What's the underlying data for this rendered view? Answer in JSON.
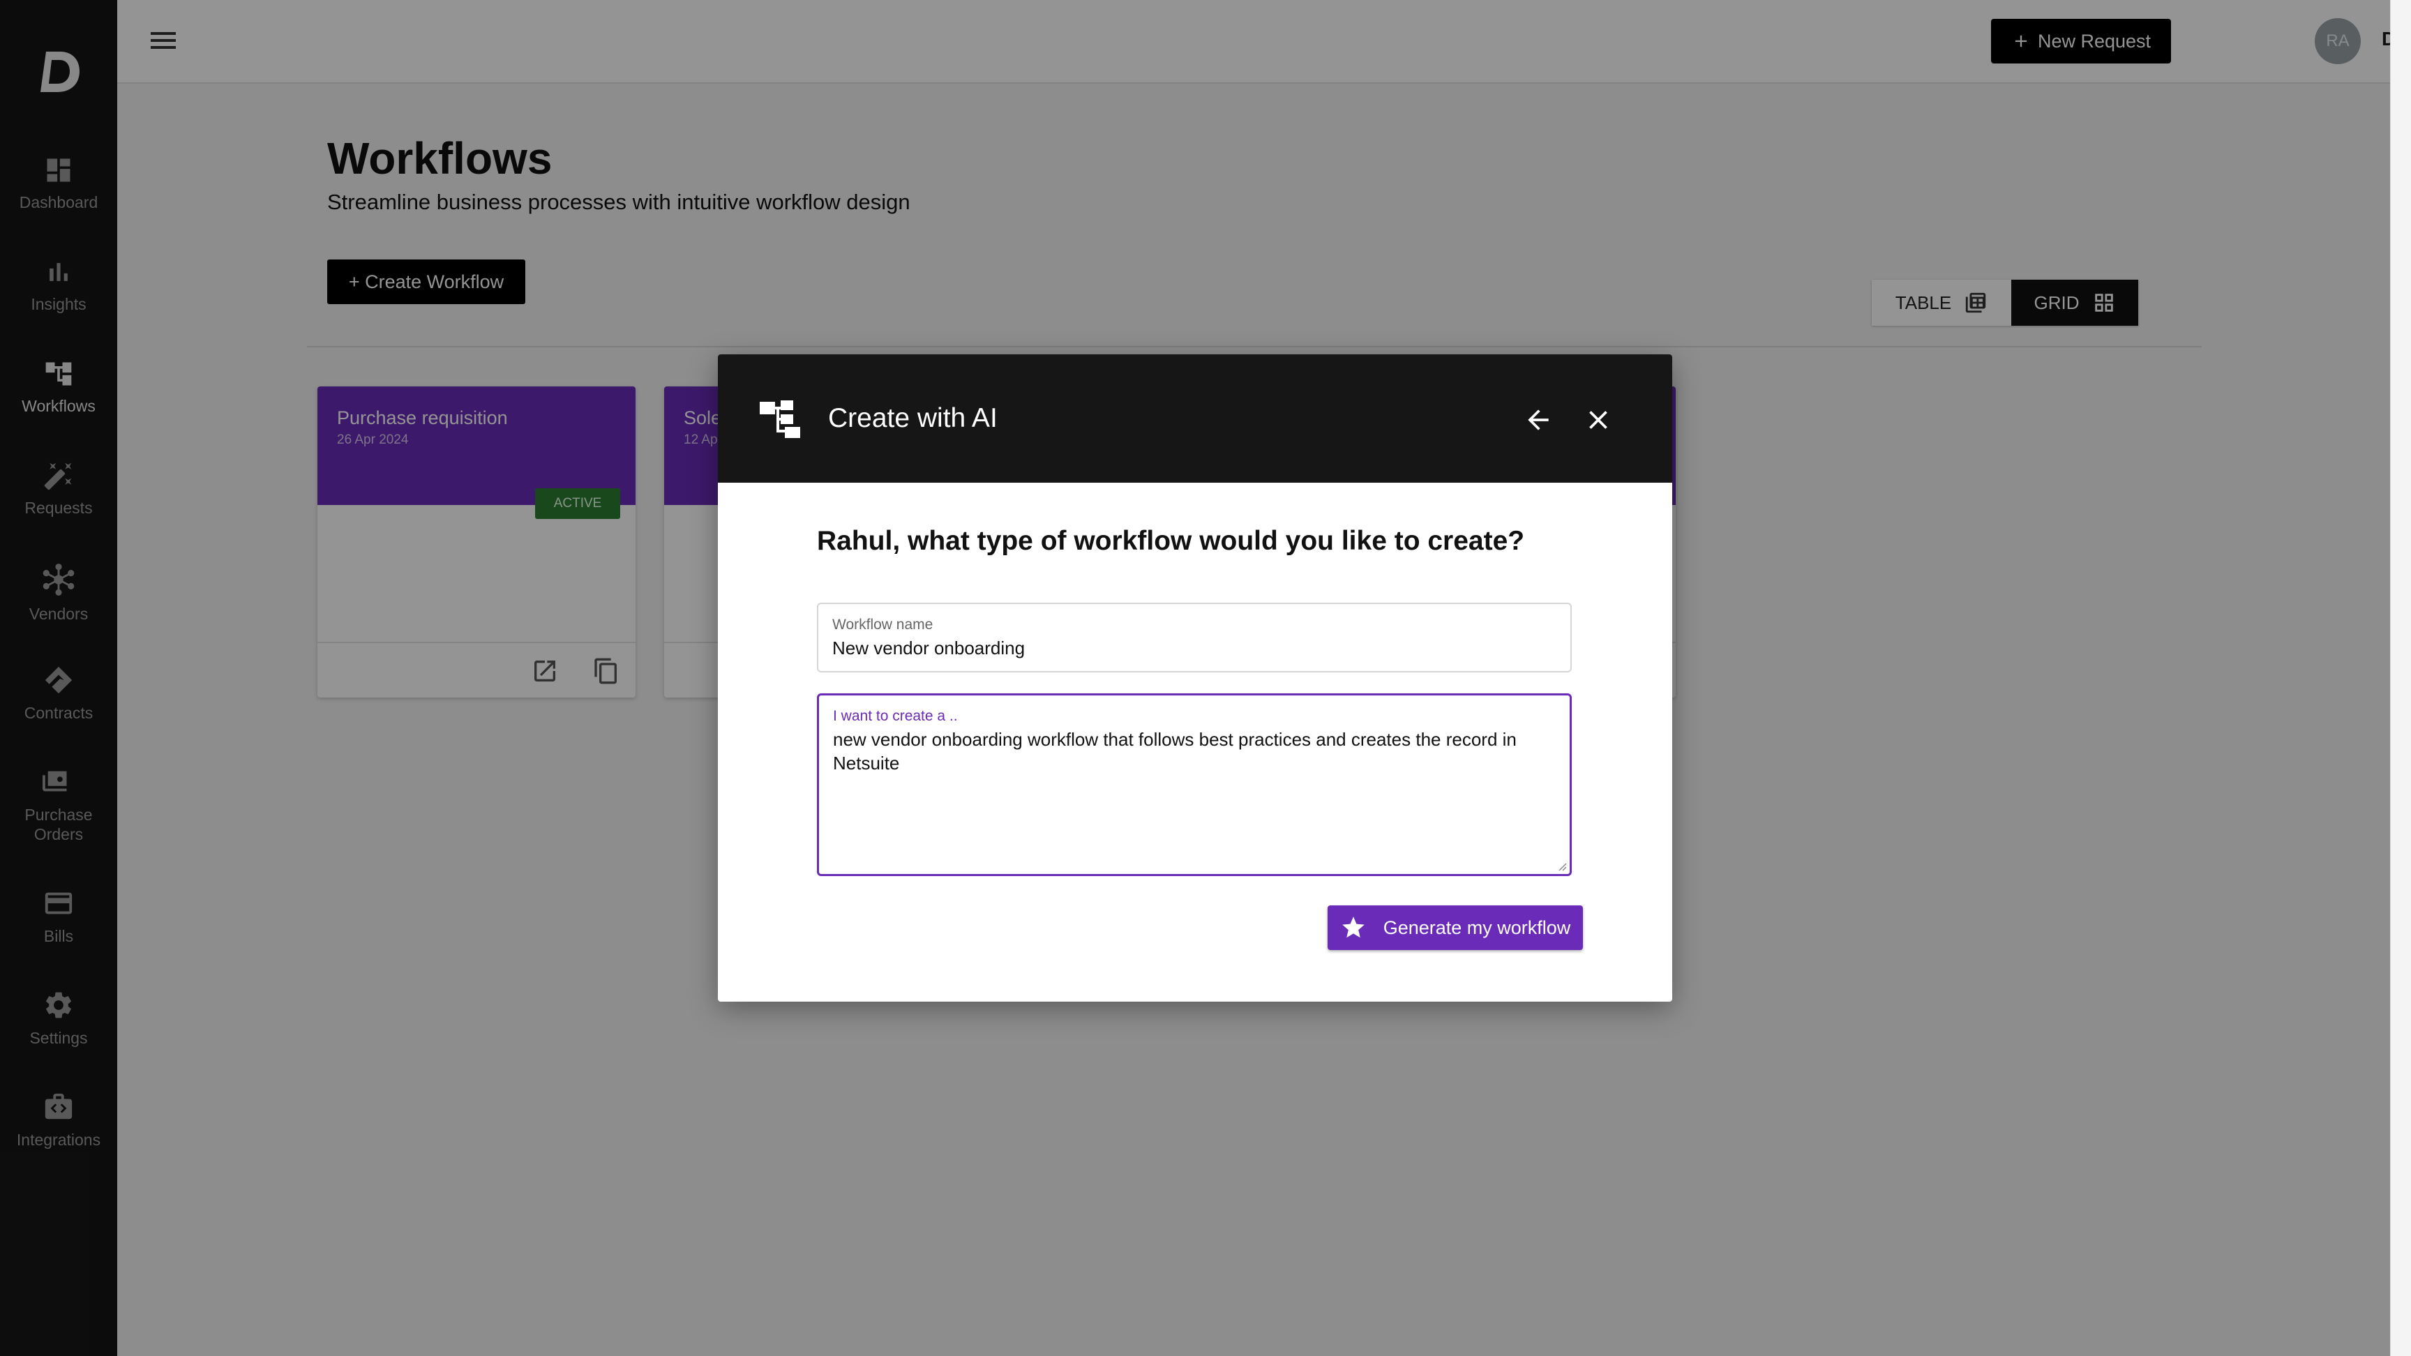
{
  "sidebar": {
    "logo": "D",
    "items": [
      {
        "label": "Dashboard",
        "icon": "dashboard-icon"
      },
      {
        "label": "Insights",
        "icon": "bar-chart-icon"
      },
      {
        "label": "Workflows",
        "icon": "workflow-icon",
        "active": true
      },
      {
        "label": "Requests",
        "icon": "magic-wand-icon"
      },
      {
        "label": "Vendors",
        "icon": "network-icon"
      },
      {
        "label": "Contracts",
        "icon": "handshake-icon"
      },
      {
        "label": "Purchase",
        "label2": "Orders",
        "icon": "purchase-orders-icon"
      },
      {
        "label": "Bills",
        "icon": "credit-card-icon"
      },
      {
        "label": "Settings",
        "icon": "gear-icon"
      },
      {
        "label": "Integrations",
        "icon": "integrations-icon"
      }
    ]
  },
  "topbar": {
    "new_request_label": "New Request",
    "avatar_initials": "RA",
    "org_name": "Derive"
  },
  "page": {
    "title": "Workflows",
    "subtitle": "Streamline business processes with intuitive workflow design",
    "create_button": "+ Create Workflow",
    "view_toggle": {
      "table_label": "TABLE",
      "grid_label": "GRID",
      "selected": "GRID"
    }
  },
  "cards": [
    {
      "title": "Purchase requisition",
      "date": "26 Apr 2024",
      "status": "ACTIVE"
    },
    {
      "title": "Sole",
      "date": "12 Ap"
    }
  ],
  "modal": {
    "title": "Create with AI",
    "question": "Rahul, what type of workflow would you like to create?",
    "name_label": "Workflow name",
    "name_value": "New vendor onboarding",
    "desc_label": "I want to create a ..",
    "desc_value": "new vendor onboarding workflow that follows best practices and creates the record in Netsuite",
    "generate_label": "Generate my workflow"
  },
  "colors": {
    "accent": "#6a2bb8",
    "sidebar_bg": "#161616",
    "active_badge": "#2e7d32"
  }
}
